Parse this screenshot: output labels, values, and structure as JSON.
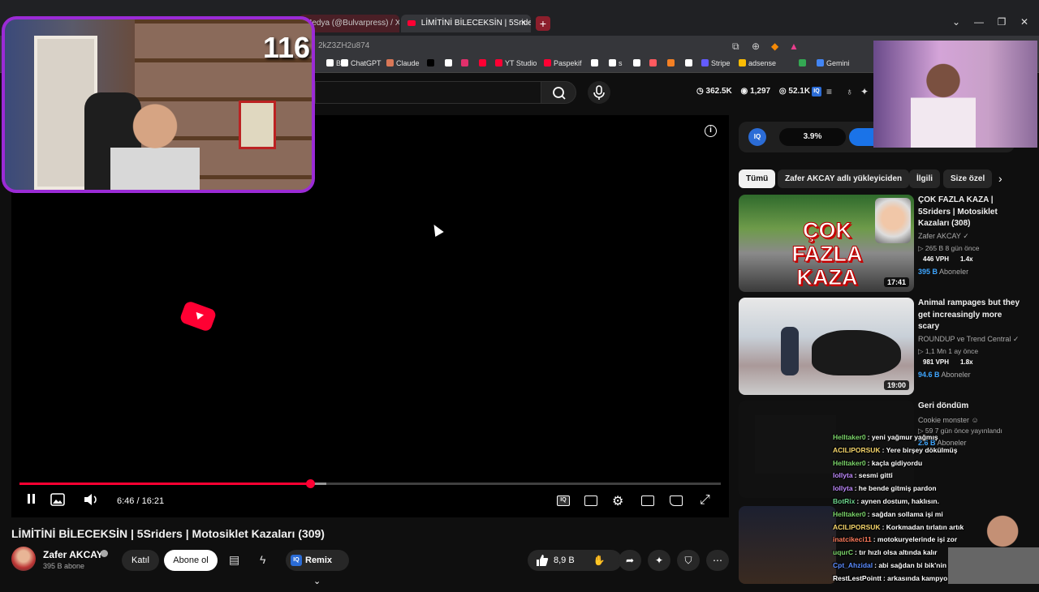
{
  "browser": {
    "tabs": [
      {
        "label": "Medya (@Bulvarpress) / X"
      },
      {
        "label": "LİMİTİNİ BİLECEKSİN | 5Sriders"
      }
    ],
    "tab_close": "×",
    "new_tab": "+",
    "url": "2kZ3ZH2u874",
    "window_controls": [
      "⌄",
      "—",
      "❐",
      "✕"
    ],
    "bookmarks": [
      {
        "label": "B",
        "color": "#ffffff"
      },
      {
        "label": "ChatGPT",
        "color": "#ffffff"
      },
      {
        "label": "Claude",
        "color": "#d97757"
      },
      {
        "label": "",
        "color": "#000000"
      },
      {
        "label": "",
        "color": "#ffffff"
      },
      {
        "label": "",
        "color": "#e1306c"
      },
      {
        "label": "",
        "color": "#ff0033"
      },
      {
        "label": "YT Studio",
        "color": "#ff0033"
      },
      {
        "label": "Paspekif",
        "color": "#ff0033"
      },
      {
        "label": "",
        "color": "#ffffff"
      },
      {
        "label": "s",
        "color": "#ffffff"
      },
      {
        "label": "",
        "color": "#ffffff"
      },
      {
        "label": "",
        "color": "#ff5a5f"
      },
      {
        "label": "",
        "color": "#f48024"
      },
      {
        "label": "",
        "color": "#ffffff"
      },
      {
        "label": "Stripe",
        "color": "#635bff"
      },
      {
        "label": "adsense",
        "color": "#fbbc04"
      },
      {
        "label": "",
        "color": "#34a853"
      },
      {
        "label": "Gemini",
        "color": "#4285f4"
      }
    ]
  },
  "header": {
    "stats": {
      "views": "362.5K",
      "likes": "1,297",
      "watching": "52.1K"
    },
    "iq_label": "IQ"
  },
  "player": {
    "time": "6:46 / 16:21",
    "progress": 0.414,
    "buffered": 0.438,
    "info_icon": "i"
  },
  "video": {
    "title": "LİMİTİNİ BİLECEKSİN | 5Sriders | Motosiklet Kazaları (309)",
    "channel": "Zafer AKCAY",
    "subscribers": "395 B abone",
    "join_label": "Katıl",
    "subscribe_label": "Abone ol",
    "remix_label": "Remix",
    "likes": "8,9 B"
  },
  "sidebar": {
    "iq_widget": {
      "logo": "IQ",
      "percent": "3.9%"
    },
    "chips": [
      "Tümü",
      "Zafer AKCAY adlı yükleyiciden",
      "İlgili",
      "Size özel"
    ],
    "recommendations": [
      {
        "title": "ÇOK FAZLA KAZA | 5Sriders | Motosiklet Kazaları (308)",
        "channel": "Zafer AKCAY",
        "meta": "▷ 265 B   8 gün önce",
        "vph": "446 VPH",
        "ratio": "1.4x",
        "subs": "395 B",
        "subs_suffix": "Aboneler",
        "duration": "17:41",
        "thumb_text": "ÇOK FAZLA KAZA"
      },
      {
        "title": "Animal rampages but they get increasingly more scary",
        "channel": "ROUNDUP ve Trend Central",
        "meta": "▷ 1,1 Mn   1 ay önce",
        "vph": "981 VPH",
        "ratio": "1.8x",
        "subs": "94.6 B",
        "subs_suffix": "Aboneler",
        "duration": "19:00"
      },
      {
        "title": "Geri döndüm",
        "channel": "Cookie monster",
        "meta": "▷ 59   7 gün önce yayınlandı",
        "subs": "2.6 B",
        "subs_suffix": "Aboneler"
      }
    ]
  },
  "overlay": {
    "viewer_count": "116",
    "chat": [
      {
        "user": "Helltaker0",
        "color": "#7cd66b",
        "msg": ": yeni yağmur yağmış"
      },
      {
        "user": "ACILIPORSUK",
        "color": "#f5d56b",
        "msg": ": Yere birşey dökülmüş"
      },
      {
        "user": "Helltaker0",
        "color": "#7cd66b",
        "msg": ": kaçla gidiyordu"
      },
      {
        "user": "lollyta",
        "color": "#c08bff",
        "msg": ": sesmi gitti"
      },
      {
        "user": "lollyta",
        "color": "#c08bff",
        "msg": ": he bende gitmiş pardon"
      },
      {
        "user": "BotRix",
        "color": "#6cd38b",
        "msg": ": aynen dostum, haklısın."
      },
      {
        "user": "Helltaker0",
        "color": "#7cd66b",
        "msg": ": sağdan sollama işi mi"
      },
      {
        "user": "ACILIPORSUK",
        "color": "#f5d56b",
        "msg": ": Korkmadan tırlatın artık"
      },
      {
        "user": "inatcikeci11",
        "color": "#ff7b5c",
        "msg": ": motokuryelerinde işi zor"
      },
      {
        "user": "uqurC",
        "color": "#7cd66b",
        "msg": ": tır hızlı olsa altında kalır"
      },
      {
        "user": "Cpt_Ahzidal",
        "color": "#5b8cff",
        "msg": ": abi sağdan bi bik'nin skora bak"
      },
      {
        "user": "RestLestPointt",
        "color": "#ffffff",
        "msg": ": arkasında kampyon var ezmemiş iyi"
      }
    ]
  },
  "colors": {
    "accent": "#ff0033",
    "iq_blue": "#2b6cd6",
    "webcam_border": "#9b2bd6",
    "background": "#0f0f0f"
  },
  "icons": {
    "search": "search-icon",
    "mic": "mic-icon",
    "pause": "pause-icon",
    "volume": "volume-icon",
    "settings": "gear-icon",
    "fullscreen": "fullscreen-icon"
  }
}
